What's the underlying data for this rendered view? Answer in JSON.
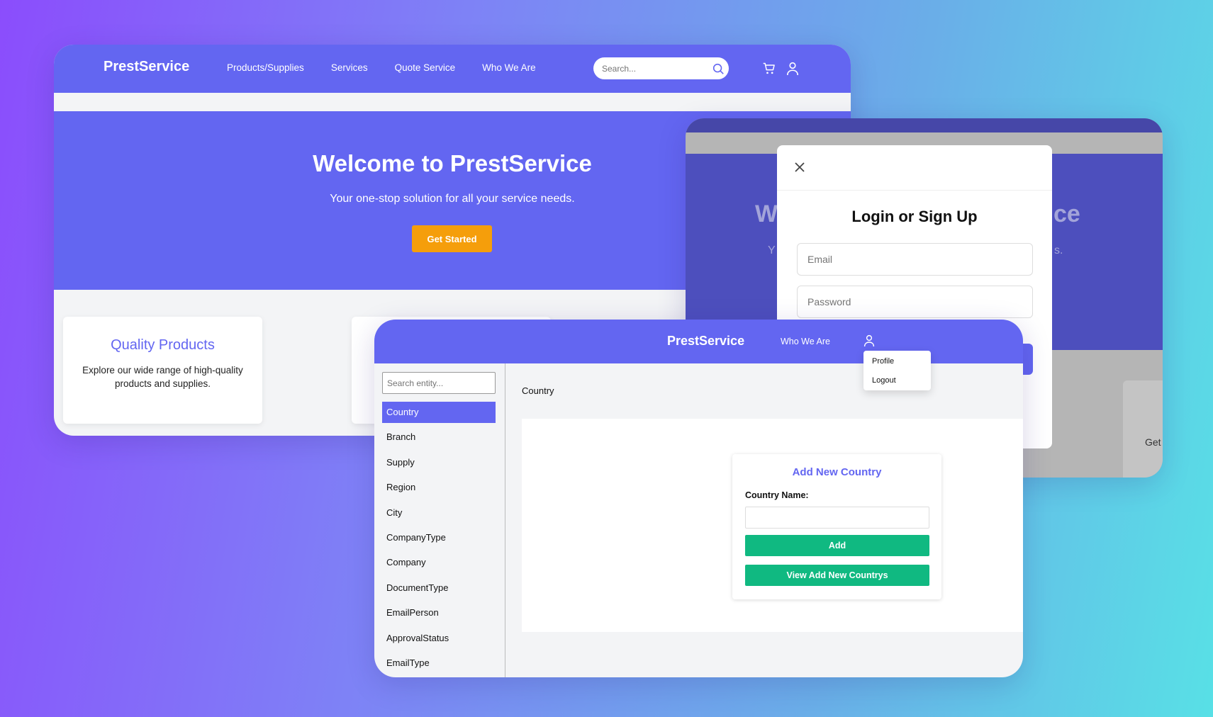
{
  "landing": {
    "brand": "PrestService",
    "nav_links": [
      "Products/Supplies",
      "Services",
      "Quote Service",
      "Who We Are"
    ],
    "search_placeholder": "Search...",
    "hero_title": "Welcome to PrestService",
    "hero_subtitle": "Your one-stop solution for all your service needs.",
    "cta_label": "Get Started",
    "cards": [
      {
        "title": "Quality Products",
        "text": "Explore our wide range of high-quality products and supplies."
      }
    ]
  },
  "login_modal": {
    "title": "Login or Sign Up",
    "email_placeholder": "Email",
    "password_placeholder": "Password",
    "bg_hero_fragment_left": "W",
    "bg_hero_fragment_right": "ce",
    "bg_sub_fragment_left": "Y",
    "bg_sub_fragment_right": "s.",
    "bg_card_fragment": "Get"
  },
  "admin": {
    "brand": "PrestService",
    "nav_link": "Who We Are",
    "user_menu": [
      "Profile",
      "Logout"
    ],
    "sidebar_search_placeholder": "Search entity...",
    "entities": [
      "Country",
      "Branch",
      "Supply",
      "Region",
      "City",
      "CompanyType",
      "Company",
      "DocumentType",
      "EmailPerson",
      "ApprovalStatus",
      "EmailType"
    ],
    "active_entity": "Country",
    "breadcrumb": "Country",
    "form": {
      "title": "Add New Country",
      "field_label": "Country Name:",
      "add_label": "Add",
      "view_label": "View Add New Countrys"
    }
  },
  "colors": {
    "primary": "#6366f1",
    "accent": "#f59e0b",
    "success": "#10b981"
  }
}
